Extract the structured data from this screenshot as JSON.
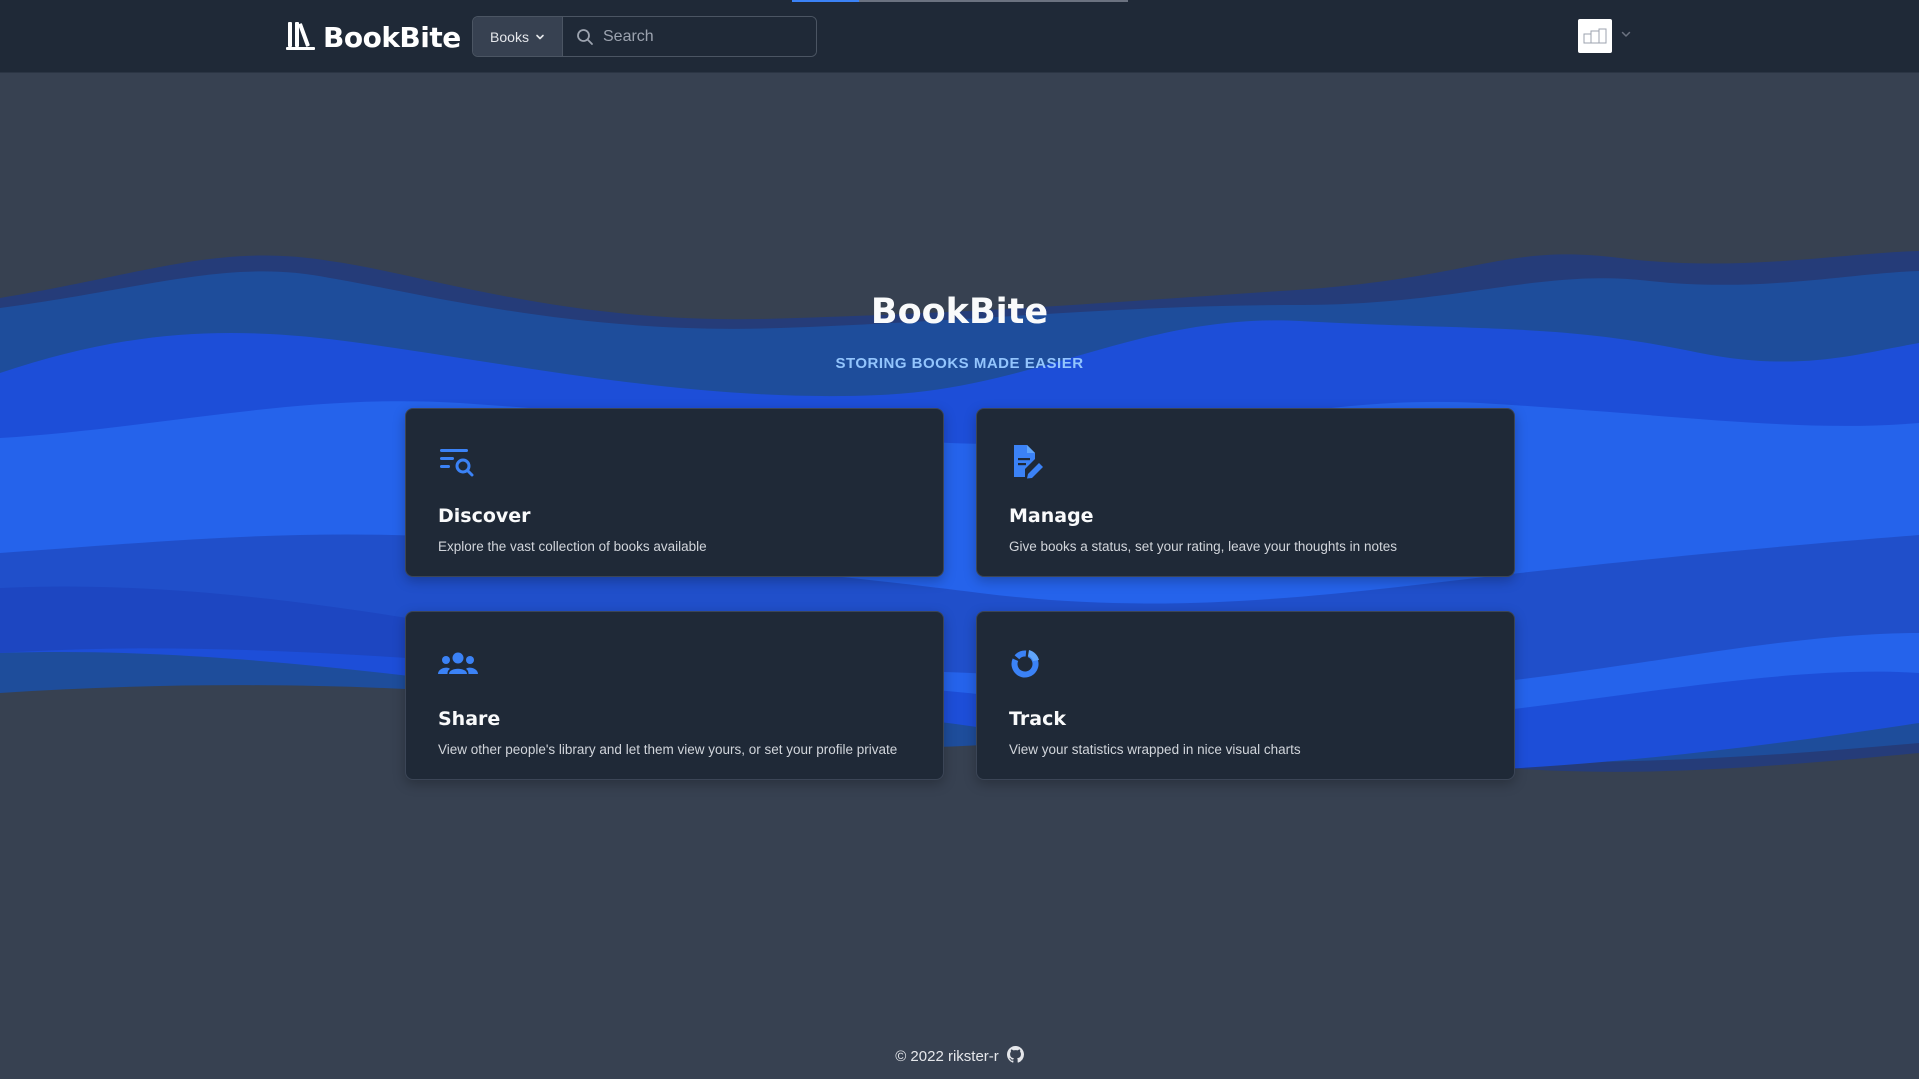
{
  "brand": {
    "name": "BookBite"
  },
  "search": {
    "category_label": "Books",
    "placeholder": "Search"
  },
  "hero": {
    "title": "BookBite",
    "subtitle": "STORING BOOKS MADE EASIER"
  },
  "features": [
    {
      "icon": "list-search-icon",
      "title": "Discover",
      "description": "Explore the vast collection of books available"
    },
    {
      "icon": "document-edit-icon",
      "title": "Manage",
      "description": "Give books a status, set your rating, leave your thoughts in notes"
    },
    {
      "icon": "users-group-icon",
      "title": "Share",
      "description": "View other people's library and let them view yours, or set your profile private"
    },
    {
      "icon": "donut-chart-icon",
      "title": "Track",
      "description": "View your statistics wrapped in nice visual charts"
    }
  ],
  "footer": {
    "copyright": "© 2022 rikster-r",
    "icon": "github-icon"
  },
  "colors": {
    "background": "#374151",
    "navbar": "#1f2937",
    "card": "#1f2937",
    "accent": "#3b82f6",
    "subtitle": "#93c5fd"
  }
}
